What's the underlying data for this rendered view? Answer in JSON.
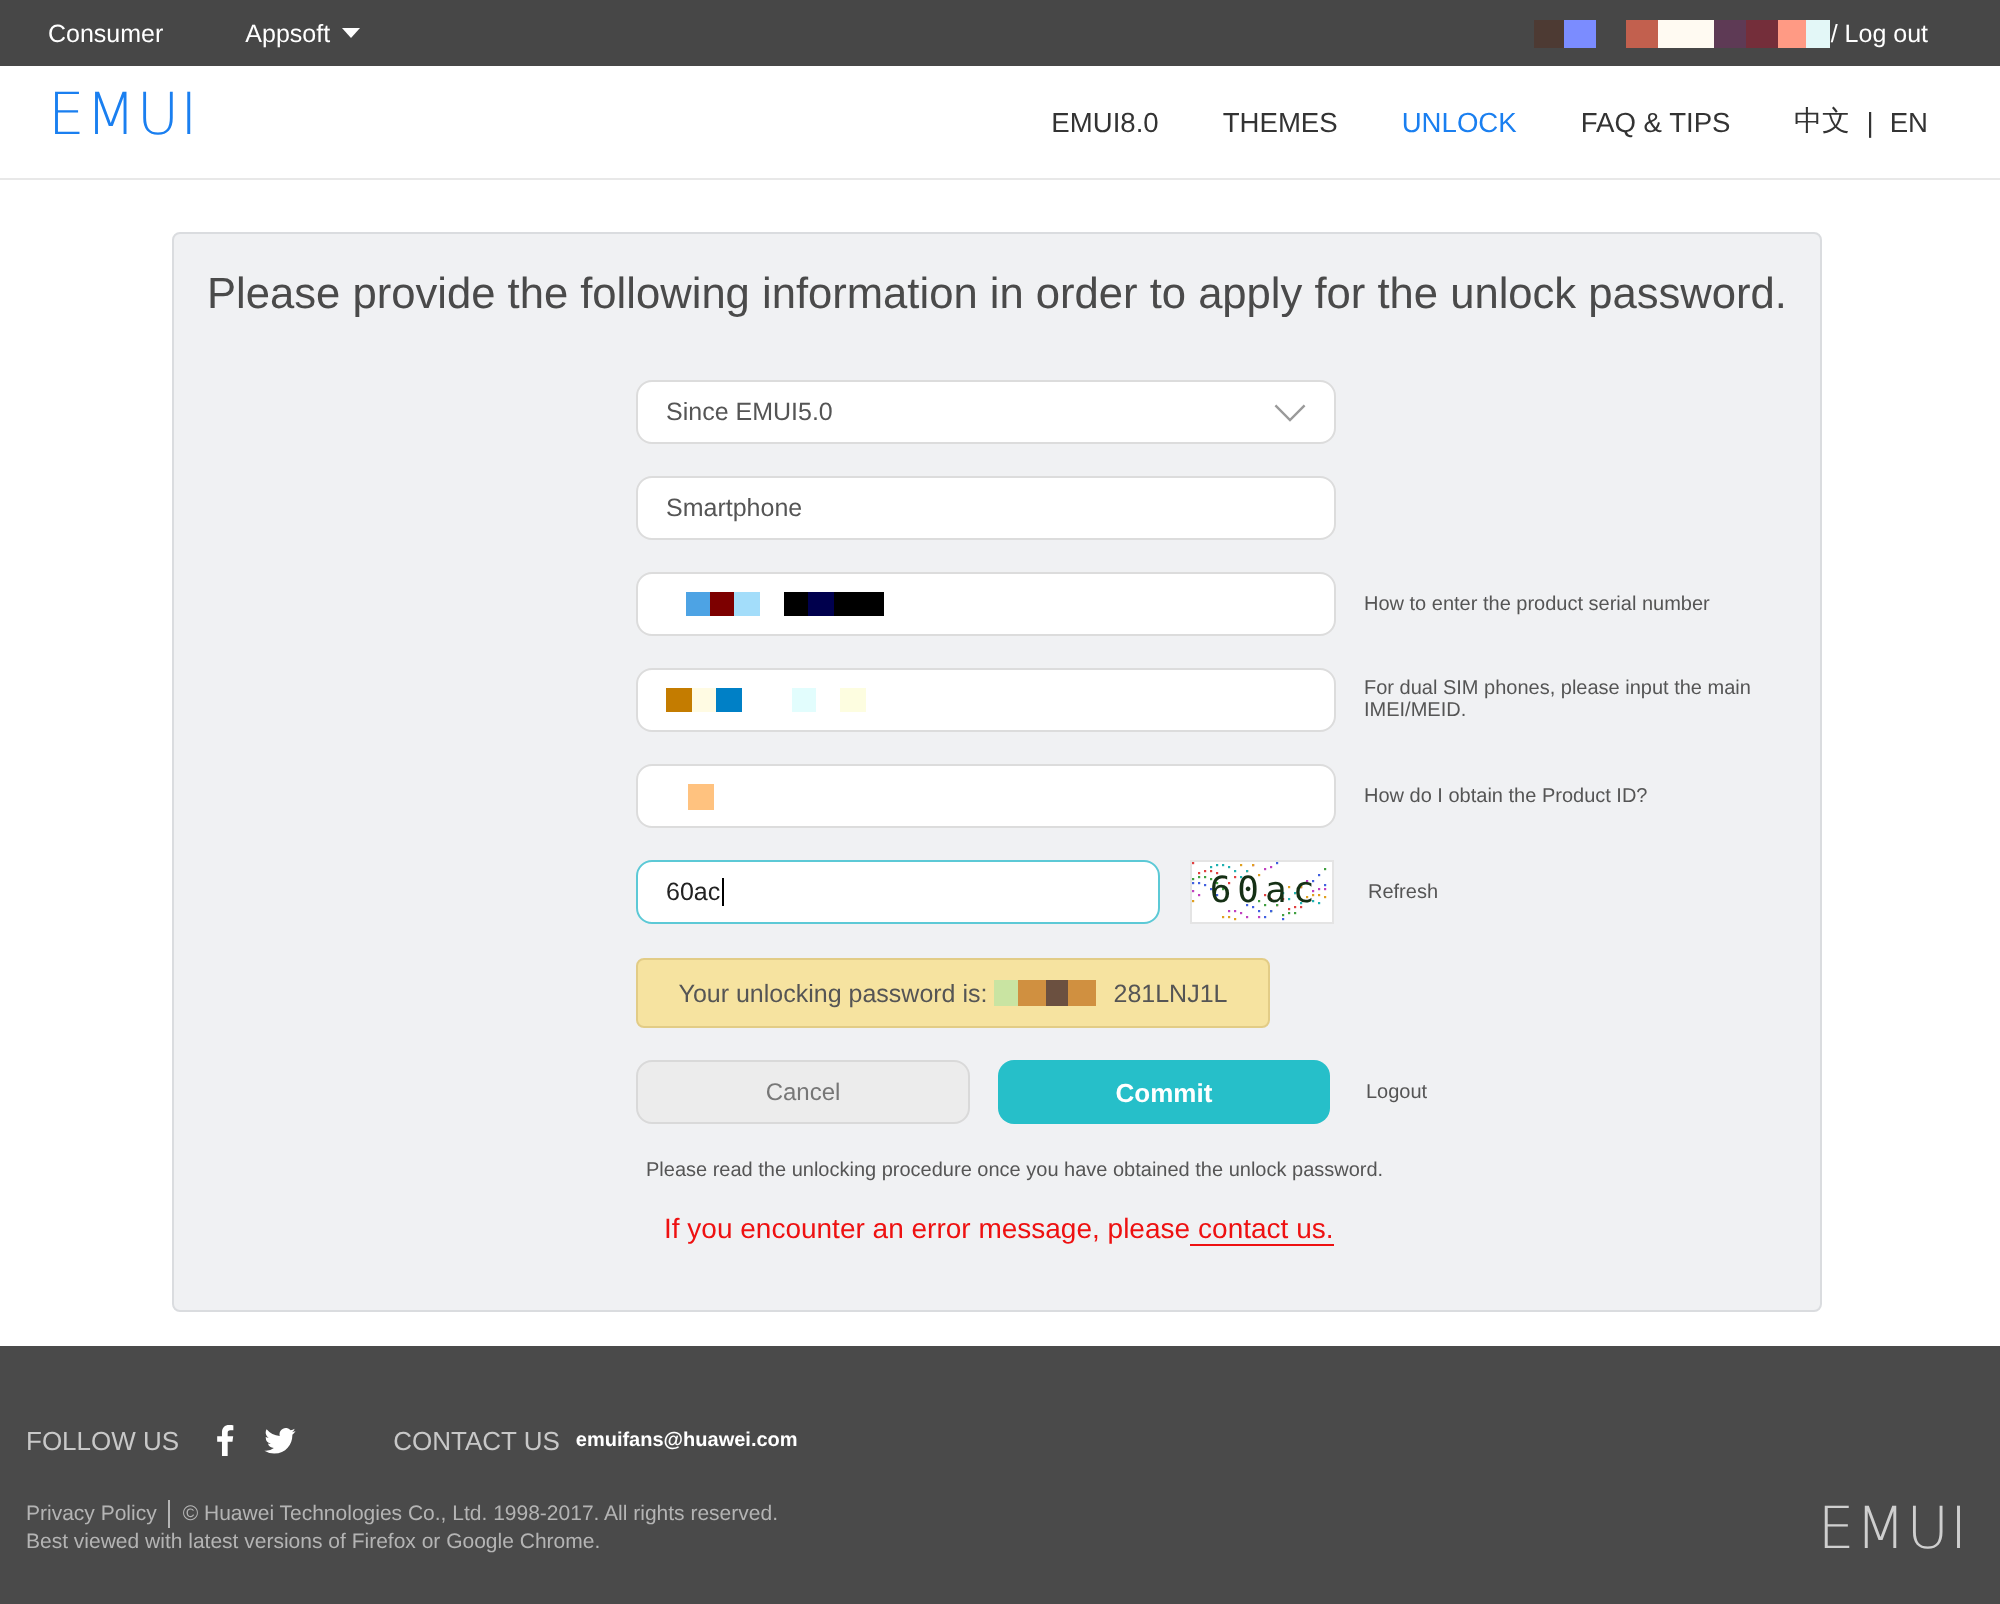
{
  "top_bar": {
    "items": [
      {
        "label": "Consumer",
        "kind": "link"
      },
      {
        "label": "Appsoft",
        "kind": "menu"
      }
    ],
    "user": {
      "redacted": true
    },
    "logout": "/ Log out"
  },
  "header": {
    "logo": "EMUI",
    "nav": [
      {
        "label": "EMUI8.0",
        "selected": false
      },
      {
        "label": "THEMES",
        "selected": false
      },
      {
        "label": "UNLOCK",
        "selected": true
      },
      {
        "label": "FAQ & TIPS",
        "selected": false
      }
    ],
    "languages": [
      "中文",
      "EN"
    ],
    "language_separator": "|"
  },
  "form": {
    "title": "Please provide the following information in order to apply for the unlock password.",
    "fields": [
      {
        "kind": "select",
        "value": "Since EMUI5.0",
        "focused": false
      },
      {
        "kind": "text",
        "value": "Smartphone",
        "focused": false
      },
      {
        "kind": "text",
        "redacted": true,
        "focused": false,
        "hint": "How to enter the product serial number"
      },
      {
        "kind": "text",
        "redacted": true,
        "focused": false,
        "hint": "For dual SIM phones, please input the main IMEI/MEID."
      },
      {
        "kind": "text",
        "redacted": true,
        "focused": false,
        "hint": "How do I obtain the Product ID?"
      },
      {
        "kind": "captcha",
        "value": "60ac",
        "focused": true,
        "captcha": "60ac",
        "hint": "Refresh"
      }
    ],
    "result": {
      "label": "Your unlocking password is:",
      "redacted": true,
      "value": "281LNJ1L"
    },
    "buttons": [
      {
        "label": "Cancel",
        "kind": "secondary"
      },
      {
        "label": "Commit",
        "kind": "primary"
      }
    ],
    "logout": "Logout",
    "note": "Please read the unlocking procedure once you have obtained the unlock password.",
    "error_note": {
      "text": "If you encounter an error message, please",
      "link": "contact us."
    }
  },
  "footer": {
    "follow_label": "FOLLOW US",
    "social": [
      {
        "kind": "facebook"
      },
      {
        "kind": "twitter"
      }
    ],
    "contact_label": "CONTACT US",
    "email": "emuifans@huawei.com",
    "legal_link": "Privacy Policy",
    "copyright": "© Huawei Technologies Co., Ltd. 1998-2017. All rights reserved.",
    "browser_note": "Best viewed with latest versions of Firefox or Google Chrome.",
    "logo": "EMUI"
  }
}
